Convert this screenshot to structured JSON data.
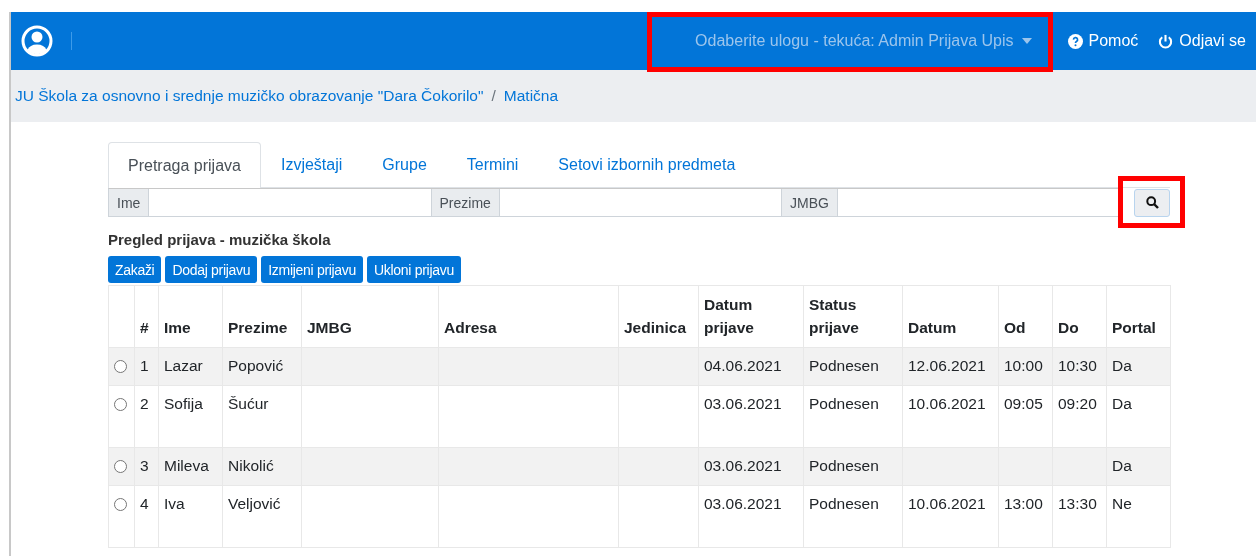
{
  "navbar": {
    "role_menu": "Odaberite ulogu - tekuća: Admin Prijava Upis",
    "help": "Pomoć",
    "logout": "Odjavi se"
  },
  "breadcrumb": {
    "separator": "/",
    "items": [
      "JU Škola za osnovno i srednje muzičko obrazovanje \"Dara Čokorilo\"",
      "Matična"
    ]
  },
  "tabs": [
    {
      "label": "Pretraga prijava",
      "selected": true
    },
    {
      "label": "Izvještaji",
      "selected": false
    },
    {
      "label": "Grupe",
      "selected": false
    },
    {
      "label": "Termini",
      "selected": false
    },
    {
      "label": "Setovi izbornih predmeta",
      "selected": false
    }
  ],
  "search": {
    "fields": [
      "Ime",
      "Prezime",
      "JMBG"
    ]
  },
  "section_title": "Pregled prijava - muzička škola",
  "buttons": [
    "Zakaži",
    "Dodaj prijavu",
    "Izmijeni prijavu",
    "Ukloni prijavu"
  ],
  "table": {
    "columns": [
      "#",
      "Ime",
      "Prezime",
      "JMBG",
      "Adresa",
      "Jedinica",
      "Datum prijave",
      "Status prijave",
      "Datum",
      "Od",
      "Do",
      "Portal"
    ],
    "rows": [
      {
        "selected": false,
        "cells": [
          "1",
          "Lazar",
          "Popović",
          null,
          null,
          null,
          "04.06.2021",
          "Podnesen",
          "12.06.2021",
          "10:00",
          "10:30",
          "Da"
        ]
      },
      {
        "selected": false,
        "cells": [
          "2",
          "Sofija",
          "Šućur",
          null,
          null,
          null,
          "03.06.2021",
          "Podnesen",
          "10.06.2021",
          "09:05",
          "09:20",
          "Da"
        ]
      },
      {
        "selected": false,
        "cells": [
          "3",
          "Mileva",
          "Nikolić",
          null,
          null,
          null,
          "03.06.2021",
          "Podnesen",
          null,
          null,
          null,
          "Da"
        ]
      },
      {
        "selected": false,
        "cells": [
          "4",
          "Iva",
          "Veljović",
          null,
          null,
          null,
          "03.06.2021",
          "Podnesen",
          "10.06.2021",
          "13:00",
          "13:30",
          "Ne"
        ]
      }
    ]
  }
}
